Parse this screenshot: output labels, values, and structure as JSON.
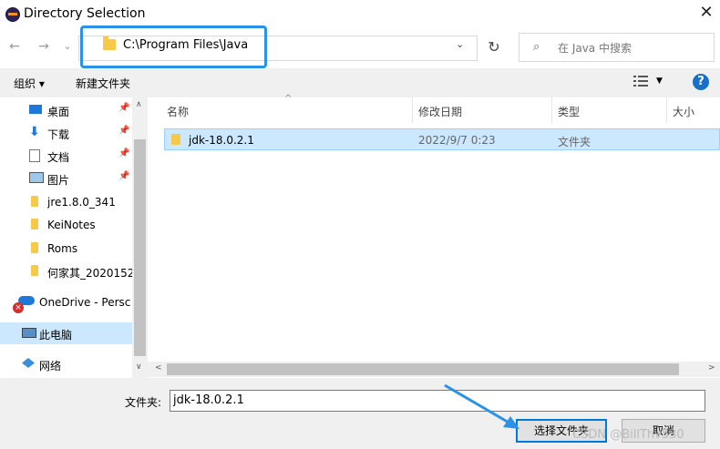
{
  "window": {
    "title": "Directory Selection",
    "close": "✕"
  },
  "nav": {
    "back": "←",
    "forward": "→",
    "recent": "⌄",
    "up": "↑",
    "address": "C:\\Program Files\\Java",
    "dropdown": "⌄",
    "refresh": "↻"
  },
  "search": {
    "icon": "⌕",
    "placeholder": "在 Java 中搜索"
  },
  "toolbar": {
    "organize": "组织 ▾",
    "new_folder": "新建文件夹",
    "view_drop": "▼",
    "help": "?"
  },
  "sidebar": {
    "items": [
      {
        "label": "桌面",
        "pinned": true
      },
      {
        "label": "下载",
        "pinned": true
      },
      {
        "label": "文档",
        "pinned": true
      },
      {
        "label": "图片",
        "pinned": true
      },
      {
        "label": "jre1.8.0_341"
      },
      {
        "label": "KeiNotes"
      },
      {
        "label": "Roms"
      },
      {
        "label": "何家其_2020152"
      },
      {
        "label": "OneDrive - Persc"
      },
      {
        "label": "此电脑"
      },
      {
        "label": "网络"
      }
    ],
    "pin_glyph": "📌",
    "scroll_up": "∧",
    "scroll_down": "∨"
  },
  "list": {
    "sort_arrow": "^",
    "columns": [
      "名称",
      "修改日期",
      "类型",
      "大小"
    ],
    "rows": [
      {
        "name": "jdk-18.0.2.1",
        "modified": "2022/9/7 0:23",
        "type": "文件夹"
      }
    ],
    "hscroll_left": "<",
    "hscroll_right": ">"
  },
  "footer": {
    "filename_label": "文件夹:",
    "filename_value": "jdk-18.0.2.1",
    "ok": "选择文件夹",
    "cancel": "取消"
  },
  "watermark": "CSDN @BillThv530",
  "colors": {
    "accent": "#0078d7",
    "selection": "#cce8ff",
    "folder": "#f7c948",
    "annotation": "#2a93e8"
  }
}
